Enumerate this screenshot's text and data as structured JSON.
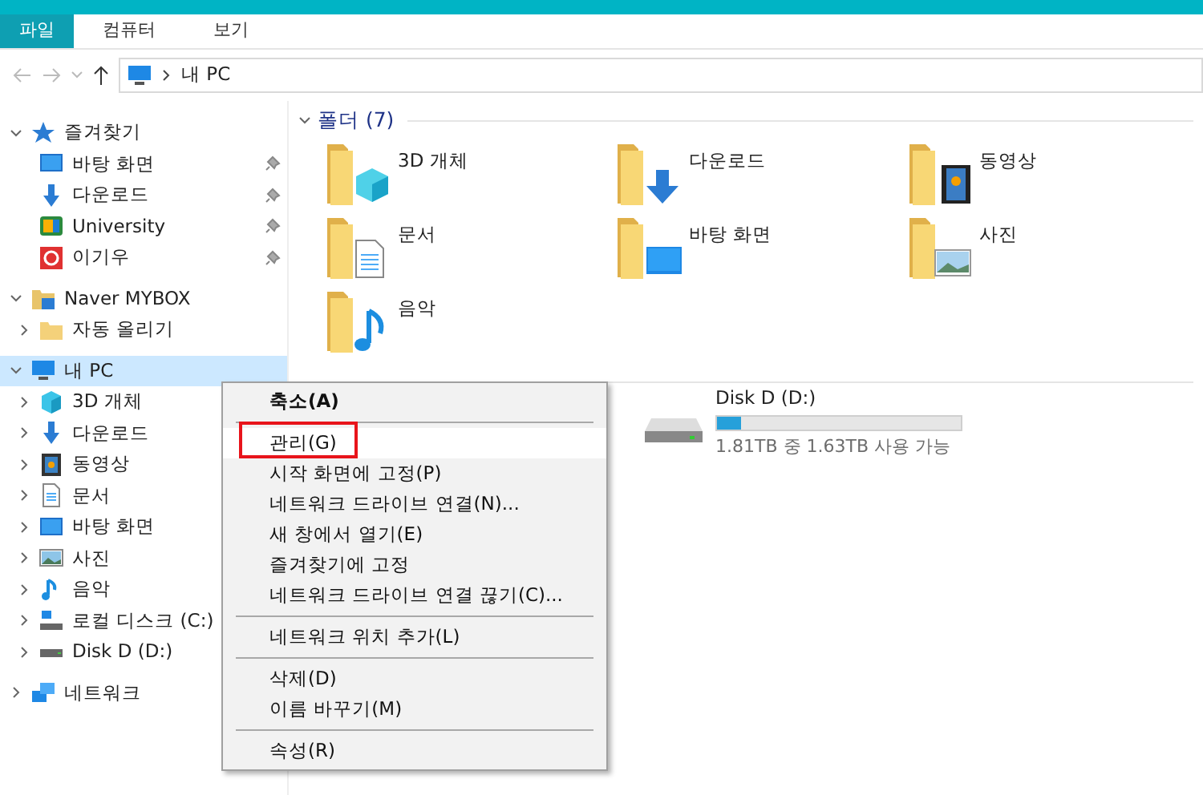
{
  "ribbon": {
    "tabs": [
      {
        "label": "파일",
        "selected": true
      },
      {
        "label": "컴퓨터",
        "selected": false
      },
      {
        "label": "보기",
        "selected": false
      }
    ]
  },
  "address": {
    "path": [
      "내 PC"
    ]
  },
  "sidebar": {
    "groups": [
      {
        "label": "즐겨찾기",
        "kind": "star",
        "expanded": true,
        "selected": false,
        "children": [
          {
            "label": "바탕 화면",
            "kind": "desktop",
            "pinned": true
          },
          {
            "label": "다운로드",
            "kind": "download",
            "pinned": true
          },
          {
            "label": "University",
            "kind": "app",
            "pinned": true
          },
          {
            "label": "이기우",
            "kind": "red",
            "pinned": true
          }
        ]
      },
      {
        "label": "Naver MYBOX",
        "kind": "cloud",
        "expanded": true,
        "selected": false,
        "children": [
          {
            "label": "자동 올리기",
            "kind": "folder",
            "expanded": false
          }
        ]
      },
      {
        "label": "내 PC",
        "kind": "pc",
        "expanded": true,
        "selected": true,
        "children": [
          {
            "label": "3D 개체",
            "kind": "cube",
            "expanded": false
          },
          {
            "label": "다운로드",
            "kind": "download",
            "expanded": false
          },
          {
            "label": "동영상",
            "kind": "film",
            "expanded": false
          },
          {
            "label": "문서",
            "kind": "doc",
            "expanded": false
          },
          {
            "label": "바탕 화면",
            "kind": "desktop",
            "expanded": false
          },
          {
            "label": "사진",
            "kind": "photo",
            "expanded": false
          },
          {
            "label": "음악",
            "kind": "music",
            "expanded": false
          },
          {
            "label": "로컬 디스크 (C:)",
            "kind": "sysdrive",
            "expanded": false
          },
          {
            "label": "Disk D (D:)",
            "kind": "drive",
            "expanded": false
          }
        ]
      },
      {
        "label": "네트워크",
        "kind": "network",
        "expanded": false,
        "selected": false
      }
    ]
  },
  "content": {
    "folders": {
      "title": "폴더 (7)",
      "expanded": true,
      "items": [
        {
          "label": "3D 개체",
          "kind": "cube"
        },
        {
          "label": "다운로드",
          "kind": "download"
        },
        {
          "label": "동영상",
          "kind": "film"
        },
        {
          "label": "문서",
          "kind": "doc"
        },
        {
          "label": "바탕 화면",
          "kind": "desktop"
        },
        {
          "label": "사진",
          "kind": "photo"
        },
        {
          "label": "음악",
          "kind": "music"
        }
      ]
    },
    "drive": {
      "label": "Disk D (D:)",
      "level": 0.1,
      "reading": "1.81TB 중 1.63TB 사용 가능"
    }
  },
  "context_menu": {
    "items": [
      {
        "kind": "item",
        "label": "축소(A)",
        "bold": true,
        "selected": false
      },
      {
        "kind": "separator"
      },
      {
        "kind": "item",
        "label": "관리(G)",
        "bold": false,
        "selected": true
      },
      {
        "kind": "item",
        "label": "시작 화면에 고정(P)",
        "bold": false,
        "selected": false
      },
      {
        "kind": "item",
        "label": "네트워크 드라이브 연결(N)...",
        "bold": false,
        "selected": false
      },
      {
        "kind": "item",
        "label": "새 창에서 열기(E)",
        "bold": false,
        "selected": false
      },
      {
        "kind": "item",
        "label": "즐겨찾기에 고정",
        "bold": false,
        "selected": false
      },
      {
        "kind": "item",
        "label": "네트워크 드라이브 연결 끊기(C)...",
        "bold": false,
        "selected": false
      },
      {
        "kind": "separator"
      },
      {
        "kind": "item",
        "label": "네트워크 위치 추가(L)",
        "bold": false,
        "selected": false
      },
      {
        "kind": "separator"
      },
      {
        "kind": "item",
        "label": "삭제(D)",
        "bold": false,
        "selected": false
      },
      {
        "kind": "item",
        "label": "이름 바꾸기(M)",
        "bold": false,
        "selected": false
      },
      {
        "kind": "separator"
      },
      {
        "kind": "item",
        "label": "속성(R)",
        "bold": false,
        "selected": false
      }
    ]
  }
}
